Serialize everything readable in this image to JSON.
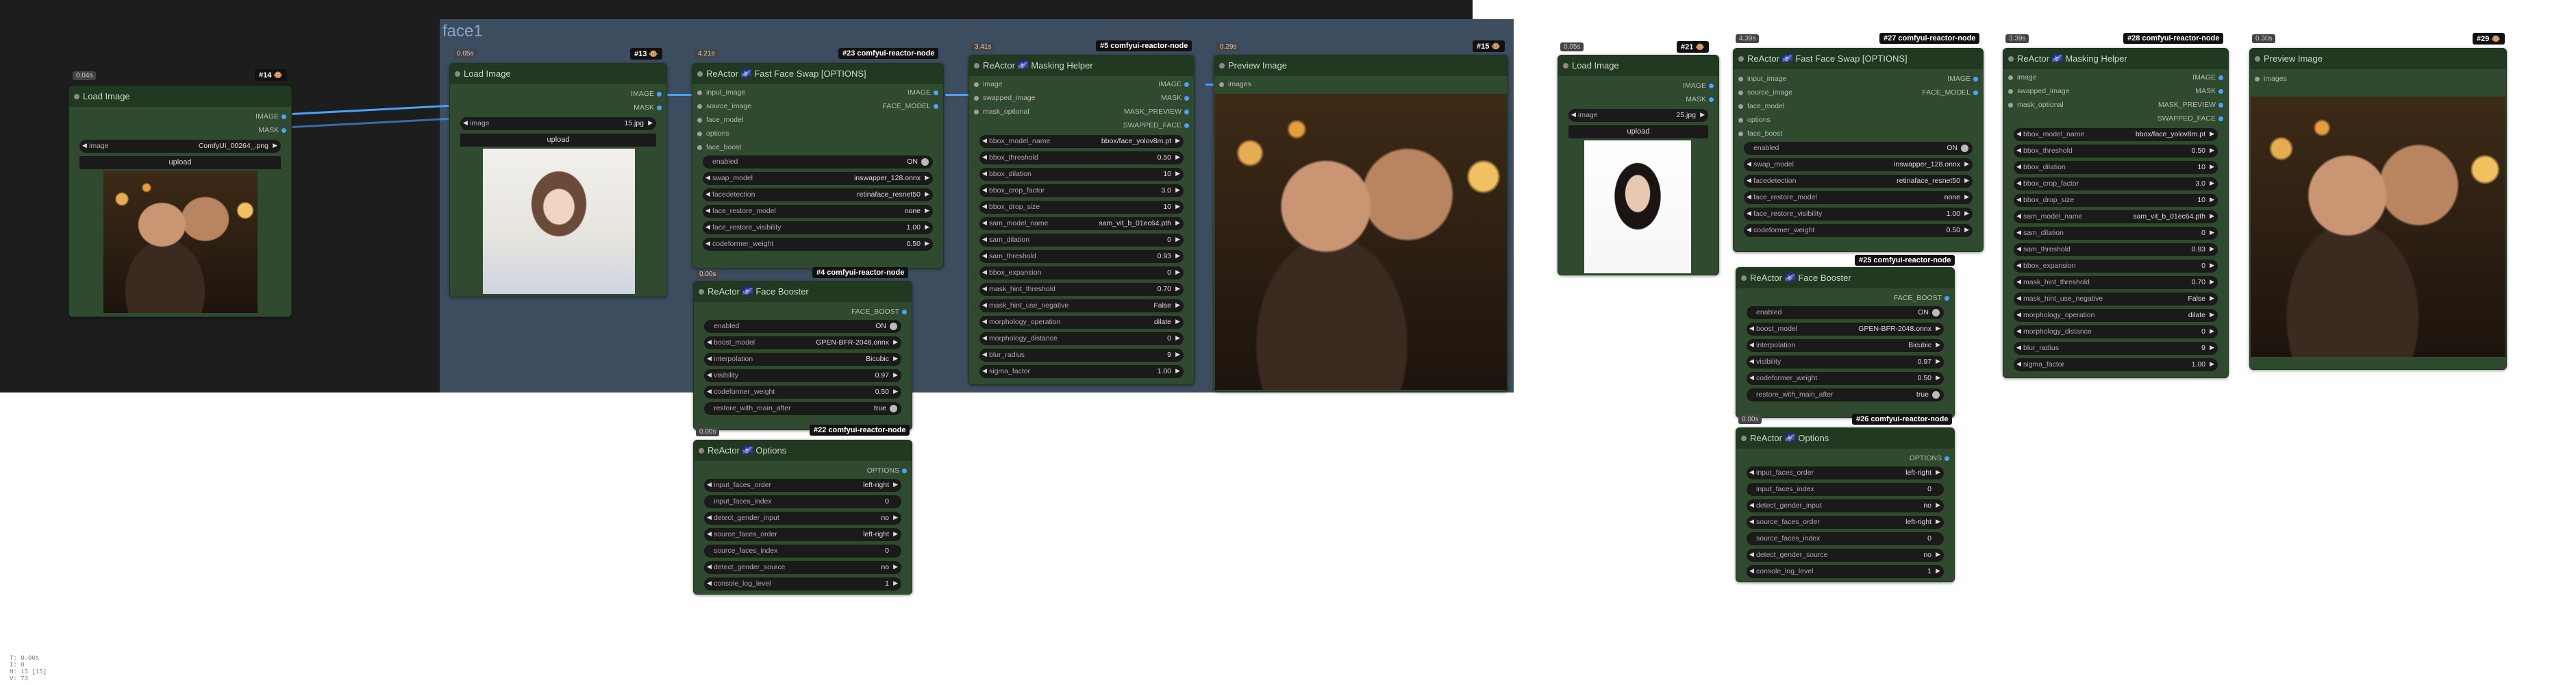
{
  "group": {
    "title": "face1"
  },
  "labels": {
    "image": "image",
    "mask": "MASK",
    "image_out": "IMAGE",
    "upload": "upload",
    "input_image": "input_image",
    "source_image": "source_image",
    "face_model": "face_model",
    "options": "options",
    "face_boost": "face_boost",
    "face_model_out": "FACE_MODEL",
    "swapped_image": "swapped_image",
    "mask_optional": "mask_optional",
    "mask_preview": "MASK_PREVIEW",
    "swapped_face": "SWAPPED_FACE",
    "images": "images",
    "face_boost_out": "FACE_BOOST",
    "options_out": "OPTIONS"
  },
  "titles": {
    "load_image": "Load Image",
    "fast_face_swap": "ReActor 🌌 Fast Face Swap [OPTIONS]",
    "masking_helper": "ReActor 🌌 Masking Helper",
    "preview_image": "Preview Image",
    "face_booster": "ReActor 🌌 Face Booster",
    "options": "ReActor 🌌 Options"
  },
  "nodes": {
    "n14": {
      "badge": "#14 🐵",
      "time": "0.04s",
      "image": "ComfyUI_00264_.png"
    },
    "n13": {
      "badge": "#13 🐵",
      "time": "0.05s",
      "image": "15.jpg"
    },
    "n23": {
      "badge": "#23 comfyui-reactor-node",
      "time": "4.21s"
    },
    "n5": {
      "badge": "#5 comfyui-reactor-node",
      "time": "3.41s"
    },
    "n15": {
      "badge": "#15 🐵",
      "time": "0.29s"
    },
    "n4": {
      "badge": "#4 comfyui-reactor-node",
      "time": "0.00s"
    },
    "n22": {
      "badge": "#22 comfyui-reactor-node",
      "time": "0.00s"
    },
    "n21": {
      "badge": "#21 🐵",
      "time": "0.05s",
      "image": "25.jpg"
    },
    "n27": {
      "badge": "#27 comfyui-reactor-node",
      "time": "4.39s"
    },
    "n28": {
      "badge": "#28 comfyui-reactor-node",
      "time": "3.39s"
    },
    "n29": {
      "badge": "#29 🐵",
      "time": "0.30s"
    },
    "n25": {
      "badge": "#25 comfyui-reactor-node",
      "time": ""
    },
    "n26": {
      "badge": "#26 comfyui-reactor-node",
      "time": "0.00s"
    }
  },
  "swap": {
    "enabled": [
      "enabled",
      "ON"
    ],
    "swap_model": [
      "swap_model",
      "inswapper_128.onnx"
    ],
    "facedetection": [
      "facedetection",
      "retinaface_resnet50"
    ],
    "face_restore_model": [
      "face_restore_model",
      "none"
    ],
    "face_restore_visibility": [
      "face_restore_visibility",
      "1.00"
    ],
    "codeformer_weight": [
      "codeformer_weight",
      "0.50"
    ]
  },
  "masking": {
    "bbox_model_name": [
      "bbox_model_name",
      "bbox/face_yolov8m.pt"
    ],
    "bbox_threshold": [
      "bbox_threshold",
      "0.50"
    ],
    "bbox_dilation": [
      "bbox_dilation",
      "10"
    ],
    "bbox_crop_factor": [
      "bbox_crop_factor",
      "3.0"
    ],
    "bbox_drop_size": [
      "bbox_drop_size",
      "10"
    ],
    "sam_model_name": [
      "sam_model_name",
      "sam_vit_b_01ec64.pth"
    ],
    "sam_dilation": [
      "sam_dilation",
      "0"
    ],
    "sam_threshold": [
      "sam_threshold",
      "0.93"
    ],
    "bbox_expansion": [
      "bbox_expansion",
      "0"
    ],
    "mask_hint_threshold": [
      "mask_hint_threshold",
      "0.70"
    ],
    "mask_hint_use_negative": [
      "mask_hint_use_negative",
      "False"
    ],
    "morphology_operation": [
      "morphology_operation",
      "dilate"
    ],
    "morphology_distance": [
      "morphology_distance",
      "0"
    ],
    "blur_radius": [
      "blur_radius",
      "9"
    ],
    "sigma_factor": [
      "sigma_factor",
      "1.00"
    ]
  },
  "booster": {
    "enabled": [
      "enabled",
      "ON"
    ],
    "boost_model": [
      "boost_model",
      "GPEN-BFR-2048.onnx"
    ],
    "interpolation": [
      "interpolation",
      "Bicubic"
    ],
    "visibility": [
      "visibility",
      "0.97"
    ],
    "codeformer_weight": [
      "codeformer_weight",
      "0.50"
    ],
    "restore_with_main_after": [
      "restore_with_main_after",
      "true"
    ]
  },
  "opts": {
    "input_faces_order": [
      "input_faces_order",
      "left-right"
    ],
    "input_faces_index": [
      "input_faces_index",
      "0"
    ],
    "detect_gender_input": [
      "detect_gender_input",
      "no"
    ],
    "source_faces_order": [
      "source_faces_order",
      "left-right"
    ],
    "source_faces_index": [
      "source_faces_index",
      "0"
    ],
    "detect_gender_source": [
      "detect_gender_source",
      "no"
    ],
    "console_log_level": [
      "console_log_level",
      "1"
    ]
  },
  "stats": {
    "line1": "T: 0.00s",
    "line2": "I: 0",
    "line3": "N: 15 [15]",
    "line4": "V: 73"
  }
}
